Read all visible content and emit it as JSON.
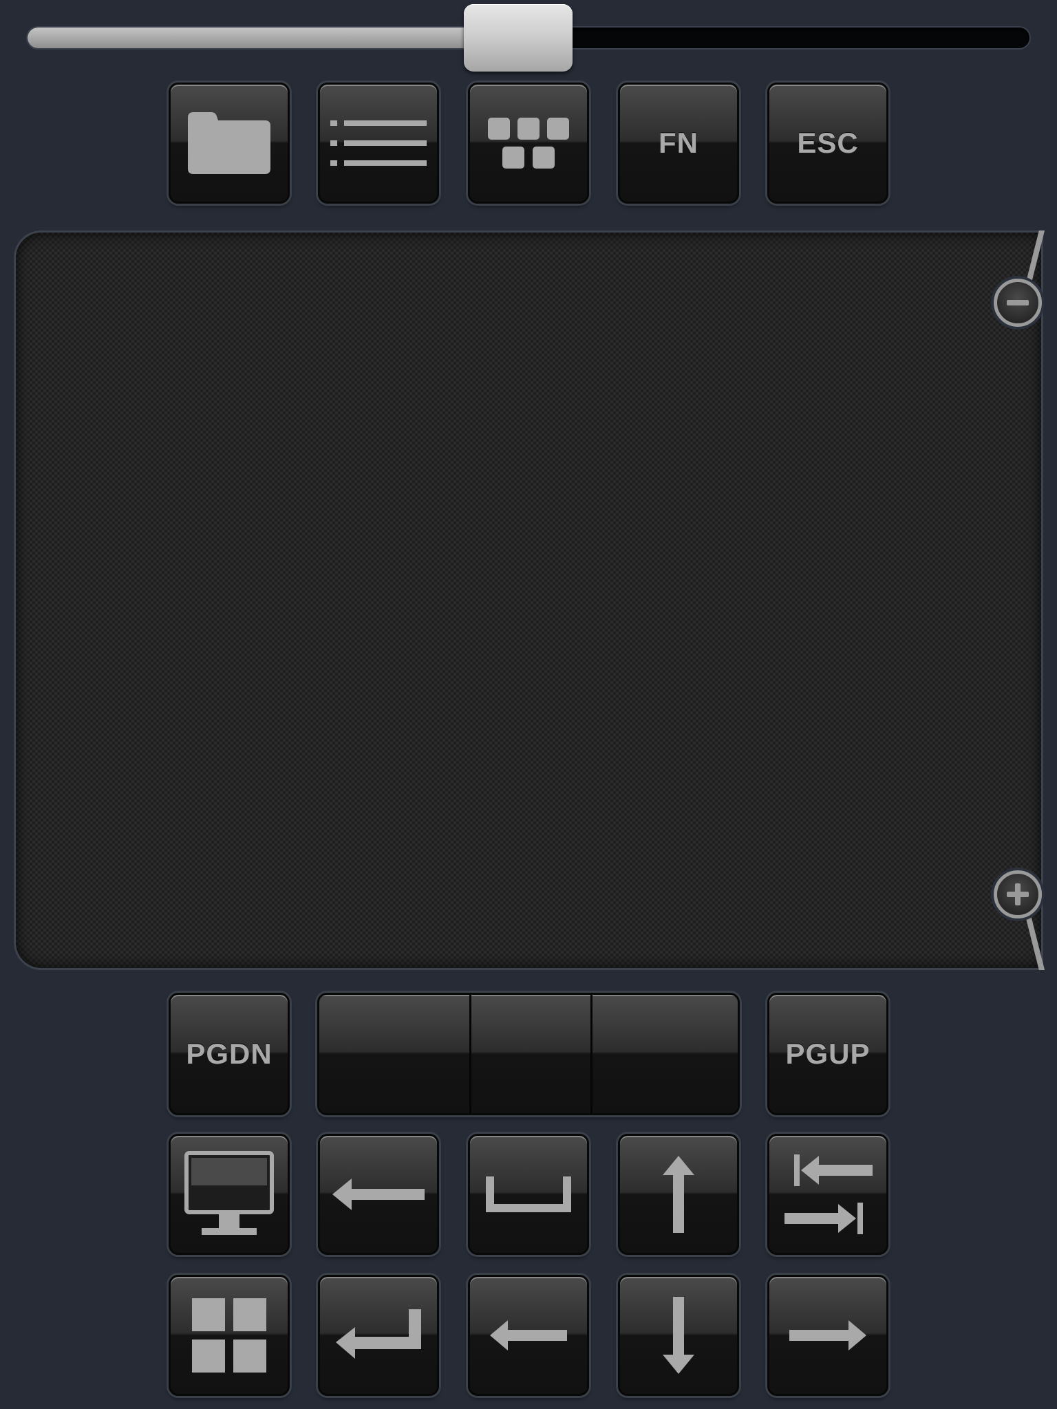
{
  "slider": {
    "value_percent": 49
  },
  "toolbar": {
    "fn_label": "FN",
    "esc_label": "ESC"
  },
  "paging": {
    "pgdn_label": "PGDN",
    "pgup_label": "PGUP"
  },
  "icons": {
    "folder": "folder-icon",
    "list": "list-icon",
    "keypad": "keypad-icon",
    "desktop": "monitor-icon",
    "backspace": "backspace-arrow-icon",
    "space": "space-bar-icon",
    "up": "arrow-up-icon",
    "tab": "tab-arrows-icon",
    "windows": "windows-icon",
    "enter": "enter-arrow-icon",
    "left": "arrow-left-icon",
    "down": "arrow-down-icon",
    "right": "arrow-right-icon",
    "zoom_out": "zoom-out-icon",
    "zoom_in": "zoom-in-icon"
  },
  "colors": {
    "background": "#262b36",
    "icon": "#a9a9a9",
    "key_top": "#4a4a4a",
    "key_bottom": "#111111",
    "slider_fill": "#b5b5b5",
    "slider_thumb": "#d9d9d9"
  }
}
